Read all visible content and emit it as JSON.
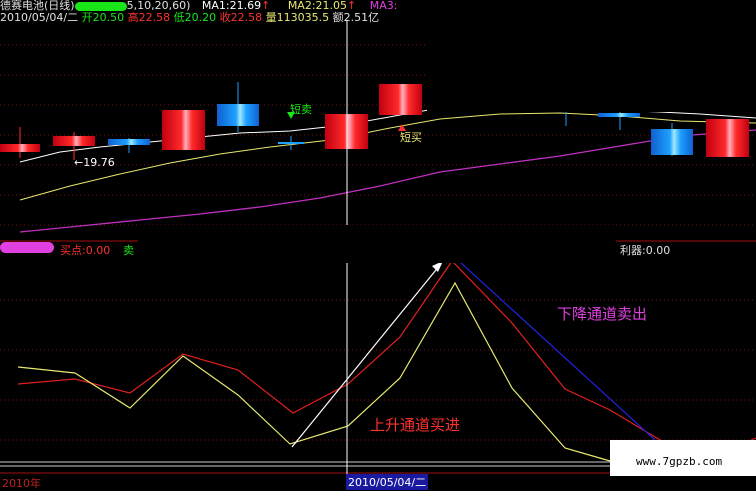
{
  "header": {
    "stock_name": "德赛电池(日线)",
    "ma_params": "5,10,20,60)",
    "ma1_label": "MA1:21.69",
    "ma2_label": "MA2:21.05",
    "ma3_label": "MA3:",
    "arrow_up": "↑",
    "date": "2010/05/04/二",
    "open": "开20.50",
    "high": "高22.58",
    "low": "低20.20",
    "close": "收22.58",
    "volume": "量113035.5",
    "amount": "额2.51亿"
  },
  "annotations": {
    "short_sell": "短卖",
    "short_buy": "短买",
    "low_price": "←19.76",
    "down_channel": "下降通道卖出",
    "up_channel": "上升通道买进"
  },
  "indicator": {
    "buy_point": "买点:0.00",
    "sell_label": "卖",
    "profit_label": "利器:0.00"
  },
  "footer": {
    "year": "2010年",
    "date": "2010/05/04/二",
    "watermark": "www.7gpzb.com"
  },
  "colors": {
    "bg": "#000000",
    "up": "#ff2a2a",
    "down": "#1ea0ff",
    "ma_white": "#ffffff",
    "ma_yellow": "#e8e870",
    "ma_magenta": "#c030c0",
    "ind_red": "#e02020",
    "ind_yellow": "#e8e870",
    "ind_blue": "#2020d0",
    "magenta_text": "#e040e0",
    "red_text": "#ff3030"
  }
}
